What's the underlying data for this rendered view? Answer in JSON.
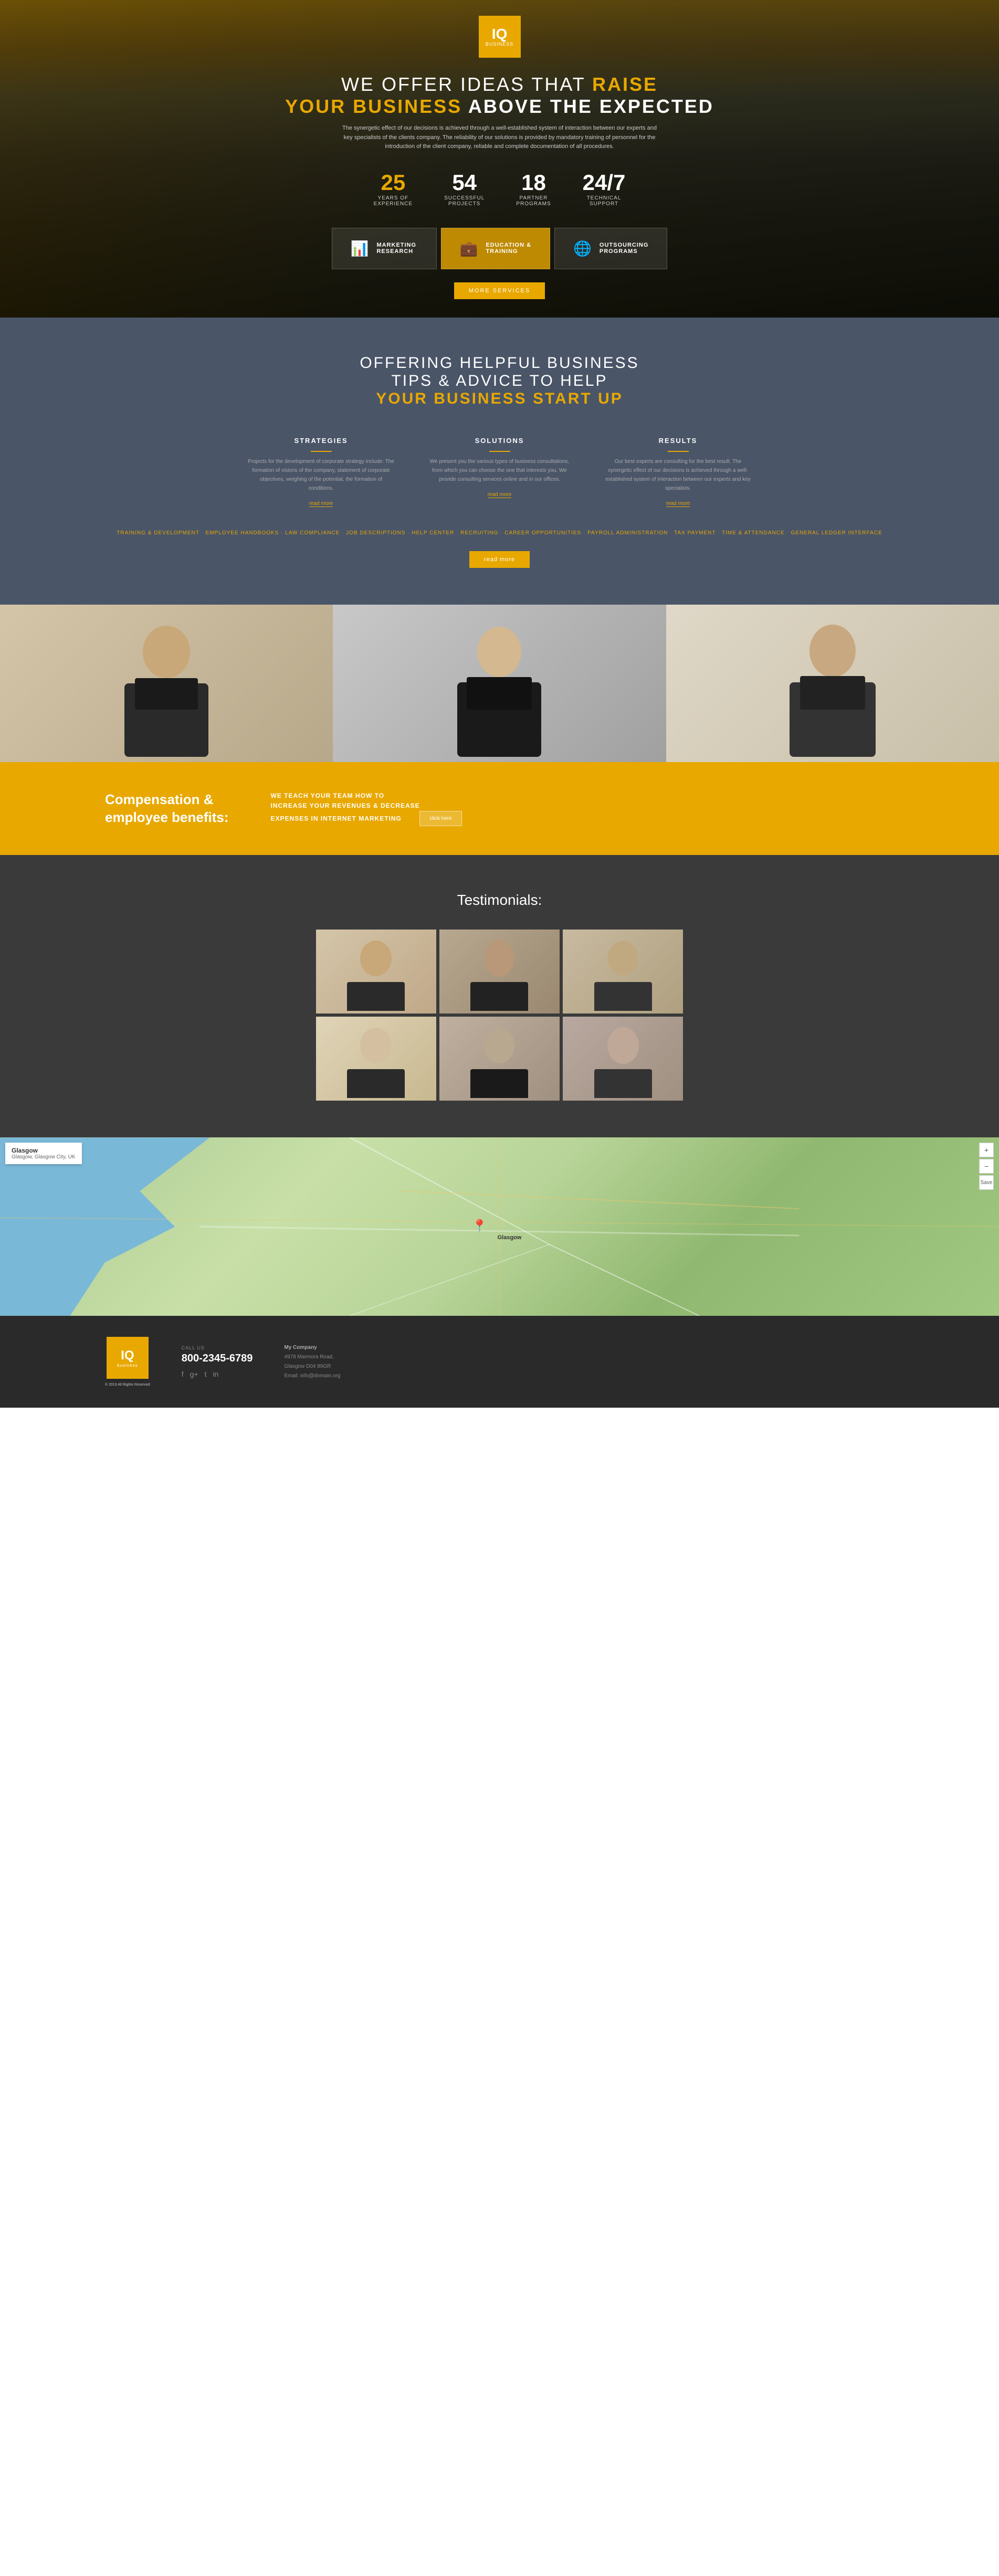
{
  "logo": {
    "iq": "IQ",
    "business": "business"
  },
  "hero": {
    "title_line1_pre": "WE OFFER IDEAS THAT ",
    "title_line1_highlight": "RAISE",
    "title_line2_pre": "YOUR BUSINESS",
    "title_line2_post": " ABOVE THE EXPECTED",
    "subtitle": "The synergetic effect of our decisions is achieved through a well-established system of interaction between our experts and key specialists of the clients company. The reliability of our solutions is provided by mandatory training of personnel for the introduction of the client company, reliable and complete documentation of all procedures.",
    "stats": [
      {
        "number": "25",
        "label": "years of\nexperience"
      },
      {
        "number": "54",
        "label": "successful\nprojects"
      },
      {
        "number": "18",
        "label": "partner\nprograms"
      },
      {
        "number": "24/7",
        "label": "technical\nsupport"
      }
    ],
    "services": [
      {
        "icon": "📊",
        "text": "MARKETING\nRESEARCH",
        "active": false
      },
      {
        "icon": "💼",
        "text": "EDUCATION &\nTRAINING",
        "active": true
      },
      {
        "icon": "🌐",
        "text": "OUTSOURCING\nPROGRAMS",
        "active": false
      }
    ],
    "more_services_label": "more services"
  },
  "tips": {
    "title_line1": "OFFERING HELPFUL BUSINESS",
    "title_line2": "TIPS & ADVICE TO HELP",
    "title_line3_pre": "YOUR BUSINESS ",
    "title_line3_highlight": "START UP",
    "columns": [
      {
        "title": "STRATEGIES",
        "text": "Projects for the development of corporate strategy include: The formation of visions of the company, statement of corporate objectives, weighing of the potential, the formation of conditions.",
        "read_more": "read more"
      },
      {
        "title": "SOLUTIONS",
        "text": "We present you the various types of business consultations, from which you can choose the one that interests you. We provide consulting services online and in our offices.",
        "read_more": "read more"
      },
      {
        "title": "RESULTS",
        "text": "Our best experts are consulting for the best result. The synergetic effect of our decisions is achieved through a well-established system of interaction between our experts and key specialists.",
        "read_more": "read more"
      }
    ],
    "tags": "TRAINING & DEVELOPMENT · EMPLOYEE HANDBOOKS · LAW COMPLIANCE · JOB DESCRIPTIONS · HELP CENTER · RECRUITING · CAREER OPPORTUNITIES · PAYROLL ADMINISTRATION · TAX PAYMENT · TIME & ATTENDANCE · GENERAL LEDGER INTERFACE",
    "read_more_label": "read more"
  },
  "compensation": {
    "title": "Compensation &\nemployee benefits:",
    "text": "WE TEACH YOUR TEAM HOW TO\nINCREASE YOUR REVENUES & DECREASE\nEXPENSES IN INTERNET MARKETING",
    "click_here": "click here"
  },
  "testimonials": {
    "title": "Testimonials:",
    "photos": [
      {
        "bg": "tp1",
        "label": "person-1"
      },
      {
        "bg": "tp2",
        "label": "person-2"
      },
      {
        "bg": "tp3",
        "label": "person-3"
      },
      {
        "bg": "tp4",
        "label": "person-4"
      },
      {
        "bg": "tp5",
        "label": "person-5"
      },
      {
        "bg": "tp6",
        "label": "person-6"
      }
    ]
  },
  "map": {
    "location_label": "Glasgow",
    "location_sub": "Glasgow, Glasgow City, UK",
    "zoom_in": "+",
    "zoom_out": "−",
    "save_label": "Save"
  },
  "footer": {
    "logo_iq": "IQ",
    "logo_business": "business",
    "logo_sub": "© 2013 All Rights Reserved",
    "call_label": "CALL US",
    "phone": "800-2345-6789",
    "social_icons": [
      "f",
      "g+",
      "t",
      "in"
    ],
    "company_name": "My Company",
    "address": "4978 Marmora Road,\nGlasgow D04 89GR",
    "email": "Email: info@domain.org"
  }
}
